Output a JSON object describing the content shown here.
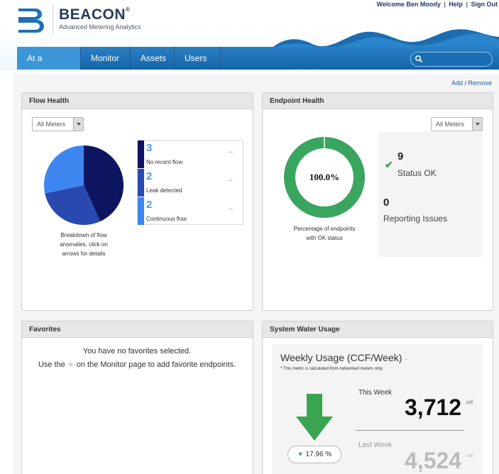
{
  "header": {
    "brand": "BEACON",
    "trademark": "®",
    "tagline": "Advanced Metering Analytics",
    "welcome": "Welcome Ben Moody",
    "help": "Help",
    "sign_out": "Sign Out",
    "sep": "|"
  },
  "nav": {
    "tabs": [
      {
        "label": "At a Glance",
        "active": true
      },
      {
        "label": "Monitor",
        "active": false
      },
      {
        "label": "Assets",
        "active": false
      },
      {
        "label": "Users",
        "active": false
      }
    ],
    "search_placeholder": ""
  },
  "add_remove": "Add / Remove",
  "flow_health": {
    "title": "Flow Health",
    "filter": "All Meters",
    "items": [
      {
        "count": "3",
        "label": "No recent flow",
        "color": "#0d1560"
      },
      {
        "count": "2",
        "label": "Leak detected",
        "color": "#2a49b0"
      },
      {
        "count": "2",
        "label": "Continuous flow",
        "color": "#3d86f0"
      }
    ],
    "arrow": "→",
    "caption_lines": [
      "Breakdown of flow",
      "anomalies, click on",
      "arrows for details"
    ]
  },
  "endpoint_health": {
    "title": "Endpoint Health",
    "filter": "All Meters",
    "percent": "100.0%",
    "percent_value": 100,
    "ring_color": "#3aa55f",
    "caption_lines": [
      "Percentage of endpoints",
      "with OK status"
    ],
    "ok_count": "9",
    "ok_label": "Status OK",
    "issues_count": "0",
    "issues_label": "Reporting Issues"
  },
  "favorites": {
    "title": "Favorites",
    "line1": "You have no favorites selected.",
    "line2_before": "Use the",
    "star": "★",
    "line2_after": "on the Monitor page to add favorite endpoints."
  },
  "water_usage": {
    "title": "System Water Usage",
    "chart_title": "Weekly Usage (CCF/Week)",
    "chart_title_suffix": "·",
    "note": "* This metric is calculated from networked meters only.",
    "this_week_label": "This Week",
    "this_week_value": "3,712",
    "last_week_label": "Last Week",
    "last_week_value": "4,524",
    "unit": "ccf",
    "change": "17.96 %",
    "change_icon": "▼",
    "arrow_color": "#3aa550"
  },
  "colors": {
    "nav_blue": "#1565a8",
    "nav_active": "#3b95d6",
    "brand_navy": "#2a3c5a"
  }
}
